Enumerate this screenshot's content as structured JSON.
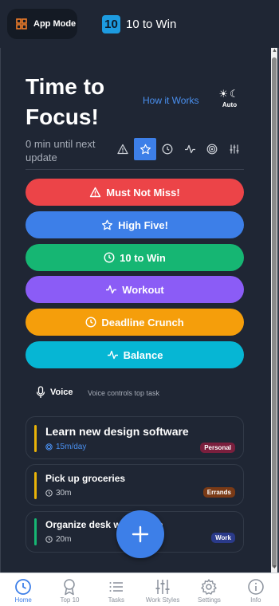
{
  "topbar": {
    "app_mode_label": "App Mode",
    "brand_logo": "10",
    "brand_name": "10 to Win"
  },
  "header": {
    "title": "Time to Focus!",
    "how_it_works": "How it Works",
    "theme_label": "Auto",
    "until_update": "0 min until next update"
  },
  "filters": [
    {
      "icon": "warning-icon",
      "active": false
    },
    {
      "icon": "star-icon",
      "active": true
    },
    {
      "icon": "clock-icon",
      "active": false
    },
    {
      "icon": "pulse-icon",
      "active": false
    },
    {
      "icon": "target-icon",
      "active": false
    },
    {
      "icon": "sliders-icon",
      "active": false
    }
  ],
  "modes": [
    {
      "label": "Must Not Miss!",
      "icon": "warning-icon",
      "color": "#ec4448"
    },
    {
      "label": "High Five!",
      "icon": "star-icon",
      "color": "#3d7fe8"
    },
    {
      "label": "10 to Win",
      "icon": "clock-icon",
      "color": "#16b673"
    },
    {
      "label": "Workout",
      "icon": "pulse-icon",
      "color": "#8b5cf6"
    },
    {
      "label": "Deadline Crunch",
      "icon": "clock-icon",
      "color": "#f59e0b"
    },
    {
      "label": "Balance",
      "icon": "pulse-icon",
      "color": "#06b6d4"
    }
  ],
  "voice": {
    "label": "Voice",
    "hint": "Voice controls top task"
  },
  "tasks": [
    {
      "title": "Learn new design software",
      "meta": "15m/day",
      "tag": "Personal",
      "bar_color": "#eab308",
      "tag_color": "#7a1f3d",
      "meta_color": "#4a90f0"
    },
    {
      "title": "Pick up groceries",
      "meta": "30m",
      "tag": "Errands",
      "bar_color": "#eab308",
      "tag_color": "#7a3a16",
      "meta_color": "#c8ccd3"
    },
    {
      "title": "Organize desk workspace",
      "meta": "20m",
      "tag": "Work",
      "bar_color": "#16b673",
      "tag_color": "#2a3a8a",
      "meta_color": "#c8ccd3"
    }
  ],
  "nav": [
    {
      "label": "Home",
      "icon": "clock-icon",
      "active": true
    },
    {
      "label": "Top 10",
      "icon": "award-icon",
      "active": false
    },
    {
      "label": "Tasks",
      "icon": "list-icon",
      "active": false
    },
    {
      "label": "Work Styles",
      "icon": "sliders-icon",
      "active": false
    },
    {
      "label": "Settings",
      "icon": "gear-icon",
      "active": false
    },
    {
      "label": "Info",
      "icon": "info-icon",
      "active": false
    }
  ]
}
